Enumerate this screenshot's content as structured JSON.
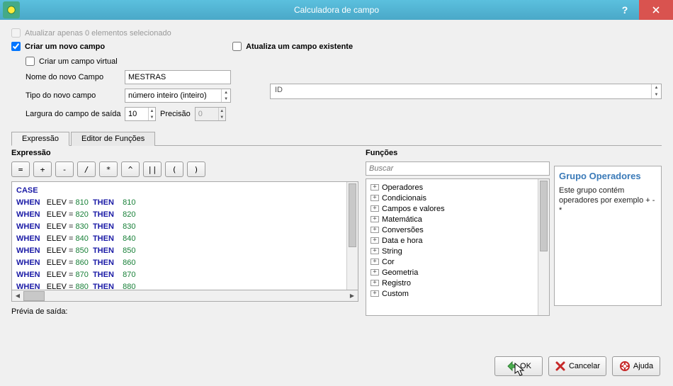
{
  "window": {
    "title": "Calculadora de campo"
  },
  "top": {
    "update_selected_label": "Atualizar apenas 0 elementos selecionado",
    "create_new_label": "Criar um novo campo",
    "update_existing_label": "Atualiza um campo existente",
    "virtual_field_label": "Criar um campo virtual"
  },
  "form": {
    "name_label": "Nome do novo Campo",
    "name_value": "MESTRAS",
    "type_label": "Tipo do novo campo",
    "type_value": "número inteiro (inteiro)",
    "width_label": "Largura do campo de saída",
    "width_value": "10",
    "precision_label": "Precisão",
    "precision_value": "0",
    "existing_field_value": "ID"
  },
  "tabs": {
    "expression": "Expressão",
    "editor": "Editor de Funções"
  },
  "expression": {
    "header": "Expressão",
    "ops": [
      "=",
      "+",
      "-",
      "/",
      "*",
      "^",
      "||",
      "(",
      ")"
    ],
    "lines": [
      {
        "kw": "CASE"
      },
      {
        "kw": "WHEN",
        "mid": "ELEV =",
        "v1": "810",
        "kw2": "THEN",
        "v2": "810"
      },
      {
        "kw": "WHEN",
        "mid": "ELEV =",
        "v1": "820",
        "kw2": "THEN",
        "v2": "820"
      },
      {
        "kw": "WHEN",
        "mid": "ELEV =",
        "v1": "830",
        "kw2": "THEN",
        "v2": "830"
      },
      {
        "kw": "WHEN",
        "mid": "ELEV =",
        "v1": "840",
        "kw2": "THEN",
        "v2": "840"
      },
      {
        "kw": "WHEN",
        "mid": "ELEV =",
        "v1": "850",
        "kw2": "THEN",
        "v2": "850"
      },
      {
        "kw": "WHEN",
        "mid": "ELEV =",
        "v1": "860",
        "kw2": "THEN",
        "v2": "860"
      },
      {
        "kw": "WHEN",
        "mid": "ELEV =",
        "v1": "870",
        "kw2": "THEN",
        "v2": "870"
      },
      {
        "kw": "WHEN",
        "mid": "ELEV =",
        "v1": "880",
        "kw2": "THEN",
        "v2": "880"
      }
    ],
    "preview_label": "Prévia de saída:"
  },
  "functions": {
    "header": "Funções",
    "search_placeholder": "Buscar",
    "groups": [
      "Operadores",
      "Condicionais",
      "Campos e valores",
      "Matemática",
      "Conversões",
      "Data e hora",
      "String",
      "Cor",
      "Geometria",
      "Registro",
      "Custom"
    ]
  },
  "help": {
    "header": "Grupo Operadores",
    "body": "Este grupo contém operadores por exemplo + - *"
  },
  "buttons": {
    "ok": "OK",
    "cancel": "Cancelar",
    "help": "Ajuda"
  }
}
